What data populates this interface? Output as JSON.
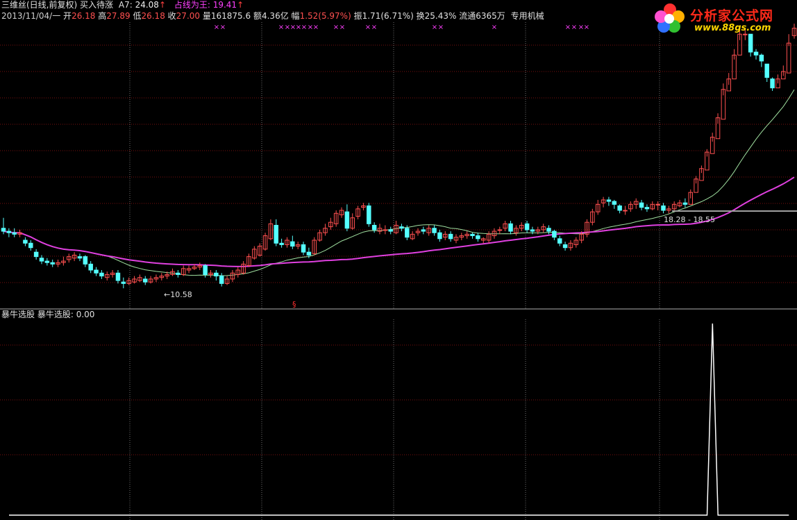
{
  "header": {
    "title": "三维丝(日线,前复权)",
    "signal_label": "买入待涨",
    "a7_label": "A7:",
    "a7_value": "24.08",
    "a7_arrow": "↑",
    "zhanxian_label": "占线为王:",
    "zhanxian_value": "19.41",
    "zhanxian_arrow": "↑",
    "date": "2013/11/04/一",
    "open_label": "开",
    "open_value": "26.18",
    "high_label": "高",
    "high_value": "27.89",
    "low_label": "低",
    "low_value": "26.18",
    "close_label": "收",
    "close_value": "27.00",
    "volume_label": "量",
    "volume_value": "161875.6",
    "amount_label": "额",
    "amount_value": "4.36亿",
    "range_label": "幅",
    "range_value": "1.52(5.97%)",
    "amplitude_label": "振",
    "amplitude_value": "1.71(6.71%)",
    "turnover_label": "换",
    "turnover_value": "25.43%",
    "float_label": "流通",
    "float_value": "6365万",
    "sector": "专用机械"
  },
  "logo": {
    "title": "分析家公式网",
    "url": "www.88gs.com"
  },
  "annotations": {
    "low_marker": "←10.58",
    "range_marker": "18.28 - 18.55",
    "signal_glyph": "§",
    "x_marker": "×"
  },
  "indicator": {
    "name": "暴牛选股",
    "value_label": "暴牛选股:",
    "value": "0.00"
  },
  "colors": {
    "up": "#ff5050",
    "down": "#54ffff",
    "ma_long": "#e040e0",
    "ma_short": "#a0e0a0",
    "grid": "#7a1010",
    "magenta": "#ff40ff"
  },
  "chart_data": [
    {
      "type": "candlestick",
      "title": "三维丝(日线,前复权)",
      "ylim": [
        9.8,
        28.4
      ],
      "x": [
        1,
        2,
        3,
        4,
        5,
        6,
        7,
        8,
        9,
        10,
        11,
        12,
        13,
        14,
        15,
        16,
        17,
        18,
        19,
        20,
        21,
        22,
        23,
        24,
        25,
        26,
        27,
        28,
        29,
        30,
        31,
        32,
        33,
        34,
        35,
        36,
        37,
        38,
        39,
        40,
        41,
        42,
        43,
        44,
        45,
        46,
        47,
        48,
        49,
        50,
        51,
        52,
        53,
        54,
        55,
        56,
        57,
        58,
        59,
        60,
        61,
        62,
        63,
        64,
        65,
        66,
        67,
        68,
        69,
        70,
        71,
        72,
        73,
        74,
        75,
        76,
        77,
        78,
        79,
        80,
        81,
        82,
        83,
        84,
        85,
        86,
        87,
        88,
        89,
        90,
        91,
        92,
        93,
        94,
        95,
        96,
        97,
        98,
        99,
        100,
        101,
        102,
        103,
        104,
        105,
        106,
        107,
        108,
        109,
        110,
        111,
        112,
        113,
        114,
        115,
        116,
        117,
        118,
        119,
        120,
        121,
        122,
        123,
        124,
        125,
        126,
        127,
        128,
        129,
        130,
        131,
        132,
        133,
        134,
        135,
        136,
        137,
        138,
        139,
        140,
        141,
        142,
        143,
        144
      ],
      "open": [
        14.6,
        14.4,
        14.3,
        14.2,
        13.8,
        13.6,
        13.0,
        12.6,
        12.4,
        12.3,
        12.2,
        12.3,
        12.5,
        12.6,
        12.7,
        12.7,
        12.2,
        11.8,
        11.6,
        11.3,
        11.5,
        11.6,
        11.0,
        10.9,
        11.0,
        11.1,
        11.2,
        11.0,
        11.2,
        11.3,
        11.4,
        11.5,
        11.6,
        11.5,
        11.8,
        11.9,
        12.0,
        12.1,
        11.5,
        11.6,
        11.4,
        10.9,
        11.2,
        11.5,
        11.6,
        12.1,
        12.6,
        12.8,
        13.2,
        13.9,
        14.8,
        13.6,
        13.5,
        13.7,
        13.4,
        13.5,
        13.0,
        12.9,
        13.8,
        14.3,
        14.7,
        14.9,
        15.5,
        15.7,
        14.6,
        15.4,
        16.0,
        16.1,
        14.8,
        14.4,
        14.5,
        14.5,
        14.3,
        14.7,
        14.6,
        13.9,
        14.3,
        14.5,
        14.3,
        14.6,
        14.3,
        14.0,
        14.2,
        13.8,
        14.0,
        14.1,
        14.2,
        14.1,
        13.8,
        13.8,
        14.1,
        14.5,
        14.6,
        14.9,
        14.3,
        14.6,
        14.9,
        14.5,
        14.4,
        14.5,
        14.6,
        14.4,
        13.9,
        13.5,
        13.3,
        13.5,
        13.8,
        14.2,
        15.0,
        15.7,
        16.3,
        16.5,
        16.4,
        16.1,
        15.8,
        15.9,
        16.2,
        16.3,
        16.0,
        15.9,
        16.2,
        16.1,
        15.8,
        15.9,
        16.1,
        16.3,
        16.2,
        17.0,
        17.8,
        18.5,
        19.6,
        20.6,
        21.9,
        23.8,
        24.6,
        26.2,
        27.6,
        27.6,
        26.4,
        26.2,
        25.6,
        24.6,
        24.0,
        24.6,
        25.0,
        27.5
      ],
      "close": [
        14.4,
        14.3,
        14.2,
        14.3,
        13.6,
        13.3,
        12.7,
        12.4,
        12.3,
        12.2,
        12.3,
        12.4,
        12.7,
        12.8,
        12.6,
        12.2,
        11.8,
        11.6,
        11.4,
        11.5,
        11.6,
        11.1,
        10.9,
        11.1,
        11.2,
        11.3,
        11.0,
        11.2,
        11.3,
        11.4,
        11.5,
        11.7,
        11.5,
        11.9,
        11.9,
        12.0,
        12.1,
        11.5,
        11.6,
        11.4,
        10.9,
        11.2,
        11.6,
        11.8,
        12.2,
        12.7,
        13.2,
        13.4,
        14.1,
        14.9,
        13.6,
        13.5,
        13.8,
        13.4,
        13.5,
        13.0,
        12.8,
        13.8,
        14.3,
        14.6,
        15.0,
        15.6,
        15.8,
        14.6,
        15.3,
        15.9,
        16.1,
        14.9,
        14.5,
        14.6,
        14.5,
        14.4,
        14.8,
        14.6,
        14.0,
        14.2,
        14.4,
        14.4,
        14.6,
        14.3,
        13.9,
        14.2,
        13.9,
        14.0,
        14.1,
        14.2,
        14.1,
        13.9,
        13.9,
        14.2,
        14.4,
        14.5,
        14.9,
        14.4,
        14.6,
        14.8,
        14.5,
        14.4,
        14.5,
        14.7,
        14.4,
        14.0,
        13.6,
        13.3,
        13.6,
        13.8,
        14.2,
        15.0,
        15.7,
        16.2,
        16.5,
        16.4,
        16.2,
        15.8,
        15.8,
        16.2,
        16.4,
        16.0,
        15.9,
        16.2,
        16.2,
        15.8,
        15.9,
        16.2,
        16.3,
        16.2,
        17.0,
        17.9,
        18.6,
        19.7,
        20.7,
        22.0,
        23.9,
        24.6,
        26.2,
        27.6,
        27.6,
        26.4,
        26.2,
        25.8,
        24.7,
        24.0,
        24.6,
        25.1,
        27.0,
        28.0
      ],
      "high": [
        15.3,
        14.6,
        14.6,
        14.5,
        14.0,
        13.8,
        13.2,
        12.8,
        12.6,
        12.5,
        12.5,
        12.7,
        12.9,
        13.0,
        12.9,
        12.8,
        12.4,
        12.0,
        11.8,
        11.7,
        11.8,
        11.8,
        11.3,
        11.3,
        11.4,
        11.5,
        11.4,
        11.4,
        11.5,
        11.6,
        11.7,
        11.9,
        11.8,
        12.1,
        12.1,
        12.2,
        12.3,
        12.2,
        11.8,
        11.8,
        11.6,
        11.4,
        11.8,
        12.0,
        12.4,
        12.9,
        13.4,
        13.6,
        14.3,
        15.2,
        15.2,
        13.9,
        14.0,
        14.1,
        13.7,
        13.7,
        13.3,
        14.0,
        14.5,
        14.9,
        15.3,
        15.8,
        16.0,
        16.2,
        15.6,
        16.1,
        16.3,
        16.3,
        15.0,
        14.9,
        14.8,
        14.7,
        15.1,
        14.9,
        14.8,
        14.4,
        14.6,
        14.7,
        14.8,
        14.8,
        14.5,
        14.4,
        14.4,
        14.2,
        14.3,
        14.4,
        14.3,
        14.3,
        14.0,
        14.4,
        14.6,
        14.7,
        15.1,
        15.1,
        14.8,
        15.0,
        15.1,
        14.7,
        14.7,
        14.9,
        14.8,
        14.5,
        14.1,
        13.7,
        13.8,
        14.0,
        14.4,
        15.2,
        15.9,
        16.5,
        16.7,
        16.7,
        16.5,
        16.2,
        16.1,
        16.4,
        16.6,
        16.5,
        16.2,
        16.4,
        16.4,
        16.3,
        16.1,
        16.4,
        16.5,
        16.6,
        17.2,
        18.1,
        18.8,
        19.9,
        21.0,
        22.3,
        24.3,
        25.0,
        26.6,
        28.1,
        28.0,
        27.5,
        26.6,
        26.3,
        25.2,
        24.7,
        24.9,
        25.5,
        27.6,
        28.3
      ],
      "low": [
        14.2,
        14.0,
        14.0,
        14.0,
        13.4,
        13.1,
        12.5,
        12.2,
        12.1,
        12.0,
        12.0,
        12.1,
        12.3,
        12.4,
        12.4,
        12.0,
        11.6,
        11.4,
        11.2,
        11.1,
        11.3,
        10.9,
        10.58,
        10.8,
        10.9,
        11.0,
        10.8,
        10.9,
        11.0,
        11.1,
        11.2,
        11.4,
        11.3,
        11.4,
        11.6,
        11.8,
        11.8,
        11.3,
        11.3,
        11.1,
        10.7,
        10.8,
        11.0,
        11.3,
        11.5,
        12.0,
        12.5,
        12.7,
        13.1,
        13.8,
        13.4,
        13.3,
        13.3,
        13.2,
        13.2,
        12.8,
        12.6,
        12.8,
        13.7,
        14.1,
        14.5,
        14.7,
        15.3,
        14.4,
        14.5,
        15.2,
        15.8,
        14.7,
        14.3,
        14.2,
        14.2,
        14.2,
        14.2,
        14.4,
        13.8,
        13.8,
        14.1,
        14.2,
        14.1,
        14.1,
        13.7,
        13.8,
        13.7,
        13.6,
        13.8,
        13.9,
        13.9,
        13.7,
        13.6,
        13.6,
        13.9,
        14.2,
        14.4,
        14.2,
        14.1,
        14.4,
        14.3,
        14.2,
        14.2,
        14.3,
        14.2,
        13.8,
        13.4,
        13.1,
        13.1,
        13.3,
        13.6,
        14.0,
        14.8,
        15.5,
        16.0,
        16.1,
        15.9,
        15.6,
        15.5,
        15.7,
        15.9,
        15.8,
        15.7,
        15.8,
        15.8,
        15.6,
        15.6,
        15.8,
        16.0,
        16.0,
        16.6,
        17.6,
        18.3,
        19.4,
        20.4,
        21.6,
        23.5,
        24.2,
        25.9,
        27.2,
        27.2,
        26.1,
        25.9,
        25.4,
        24.4,
        23.8,
        24.3,
        24.8,
        26.8,
        27.3
      ]
    },
    {
      "type": "line",
      "name": "暴牛选股",
      "ylim": [
        0,
        1
      ],
      "x_index": [
        0,
        127,
        128,
        129,
        130,
        143
      ],
      "values": [
        0,
        0,
        0,
        1,
        0,
        0
      ]
    }
  ]
}
